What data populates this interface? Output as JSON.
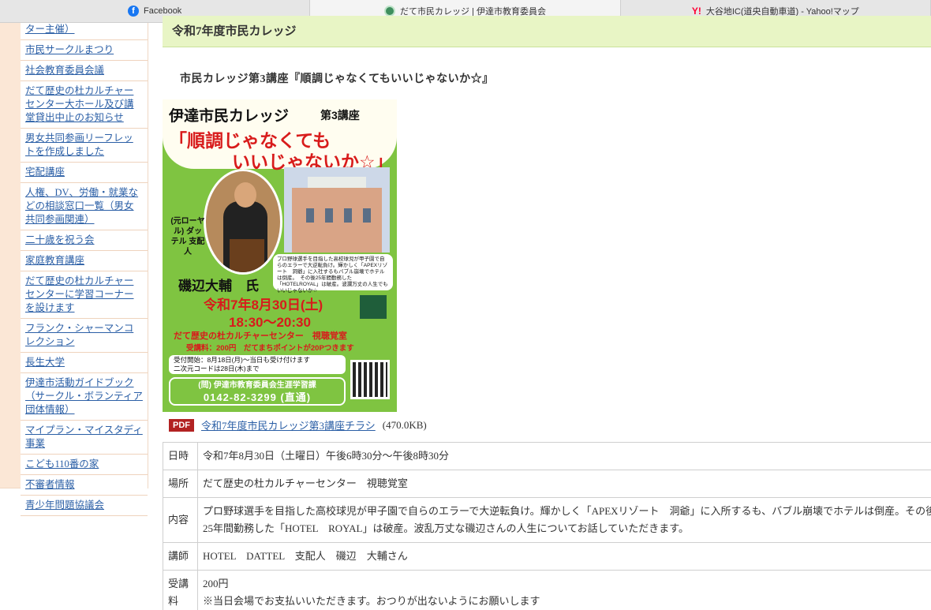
{
  "tabs": [
    {
      "label": "Facebook",
      "icon": "facebook-icon"
    },
    {
      "label": "だて市民カレッジ | 伊達市教育委員会",
      "icon": "date-city-icon"
    },
    {
      "label": "大谷地IC(道央自動車道) - Yahoo!マップ",
      "icon": "yahoo-icon"
    }
  ],
  "sidebar": {
    "items": [
      {
        "label": "ター主催）"
      },
      {
        "label": "市民サークルまつり"
      },
      {
        "label": "社会教育委員会議"
      },
      {
        "label": "だて歴史の杜カルチャーセンター大ホール及び講堂貸出中止のお知らせ"
      },
      {
        "label": "男女共同参画リーフレットを作成しました"
      },
      {
        "label": "宅配講座"
      },
      {
        "label": "人権、DV、労働・就業などの相談窓口一覧（男女共同参画関連）"
      },
      {
        "label": "二十歳を祝う会"
      },
      {
        "label": "家庭教育講座"
      },
      {
        "label": "だて歴史の杜カルチャーセンターに学習コーナーを設けます"
      },
      {
        "label": "フランク・シャーマンコレクション"
      },
      {
        "label": "長生大学"
      },
      {
        "label": "伊達市活動ガイドブック（サークル・ボランティア団体情報）"
      },
      {
        "label": "マイプラン・マイスタディ事業"
      },
      {
        "label": "こども110番の家"
      },
      {
        "label": "不審者情報"
      },
      {
        "label": "青少年問題協議会"
      }
    ]
  },
  "page": {
    "heading": "令和7年度市民カレッジ",
    "article_title": "市民カレッジ第3講座『順調じゃなくてもいいじゃないか☆』"
  },
  "flyer": {
    "title": "伊達市民カレッジ",
    "lecture": "第3講座",
    "headline1": "「順調じゃなくても",
    "headline2": "いいじゃないか☆」",
    "role": "(元ローヤル) ダッテル 支配人",
    "name": "磯辺大輔　氏",
    "desc": "プロ野球選手を目指した高校球児が甲子園で自らのエラーで大逆転負け。輝かしく「APEXリゾート　洞爺」に入社するもバブル崩壊でホテルは倒産。　その後25年間勤務した「HOTELROYAL」は破産。波瀾万丈の人生でもいいじゃないか☆",
    "date": "令和7年8月30日(土)",
    "time": "18:30〜20:30",
    "place": "だて歴史の杜カルチャーセンター　視聴覚室",
    "fee": "受講料：200円　だてまちポイントが20Pつきます",
    "reception": "受付開始：8月18日(月)〜当日も受け付けます\n二次元コードは28日(木)まで",
    "contact_org": "(問) 伊達市教育委員会生涯学習課",
    "contact_tel": "0142-82-3299 (直通)"
  },
  "pdf": {
    "badge": "PDF",
    "link_text": "令和7年度市民カレッジ第3講座チラシ",
    "size": "(470.0KB)"
  },
  "table": [
    {
      "label": "日時",
      "value": "令和7年8月30日（土曜日）午後6時30分〜午後8時30分"
    },
    {
      "label": "場所",
      "value": "だて歴史の杜カルチャーセンター　視聴覚室"
    },
    {
      "label": "内容",
      "value": "プロ野球選手を目指した高校球児が甲子園で自らのエラーで大逆転負け。輝かしく「APEXリゾート　洞爺」に入所するも、バブル崩壊でホテルは倒産。その後25年間勤務した「HOTEL　ROYAL」は破産。波乱万丈な磯辺さんの人生についてお話していただきます。"
    },
    {
      "label": "講師",
      "value": "HOTEL　DATTEL　支配人　磯辺　大輔さん"
    },
    {
      "label": "受講料",
      "value": "200円",
      "note": "※当日会場でお支払いいただきます。おつりが出ないようにお願いします"
    }
  ],
  "colors": {
    "header_bg": "#e8f5c5",
    "sidebar_bg": "#fbe7d6",
    "link": "#2b5fa6",
    "pdf_badge": "#b22222",
    "flyer_green": "#7fc441",
    "flyer_red": "#d81b1b"
  }
}
